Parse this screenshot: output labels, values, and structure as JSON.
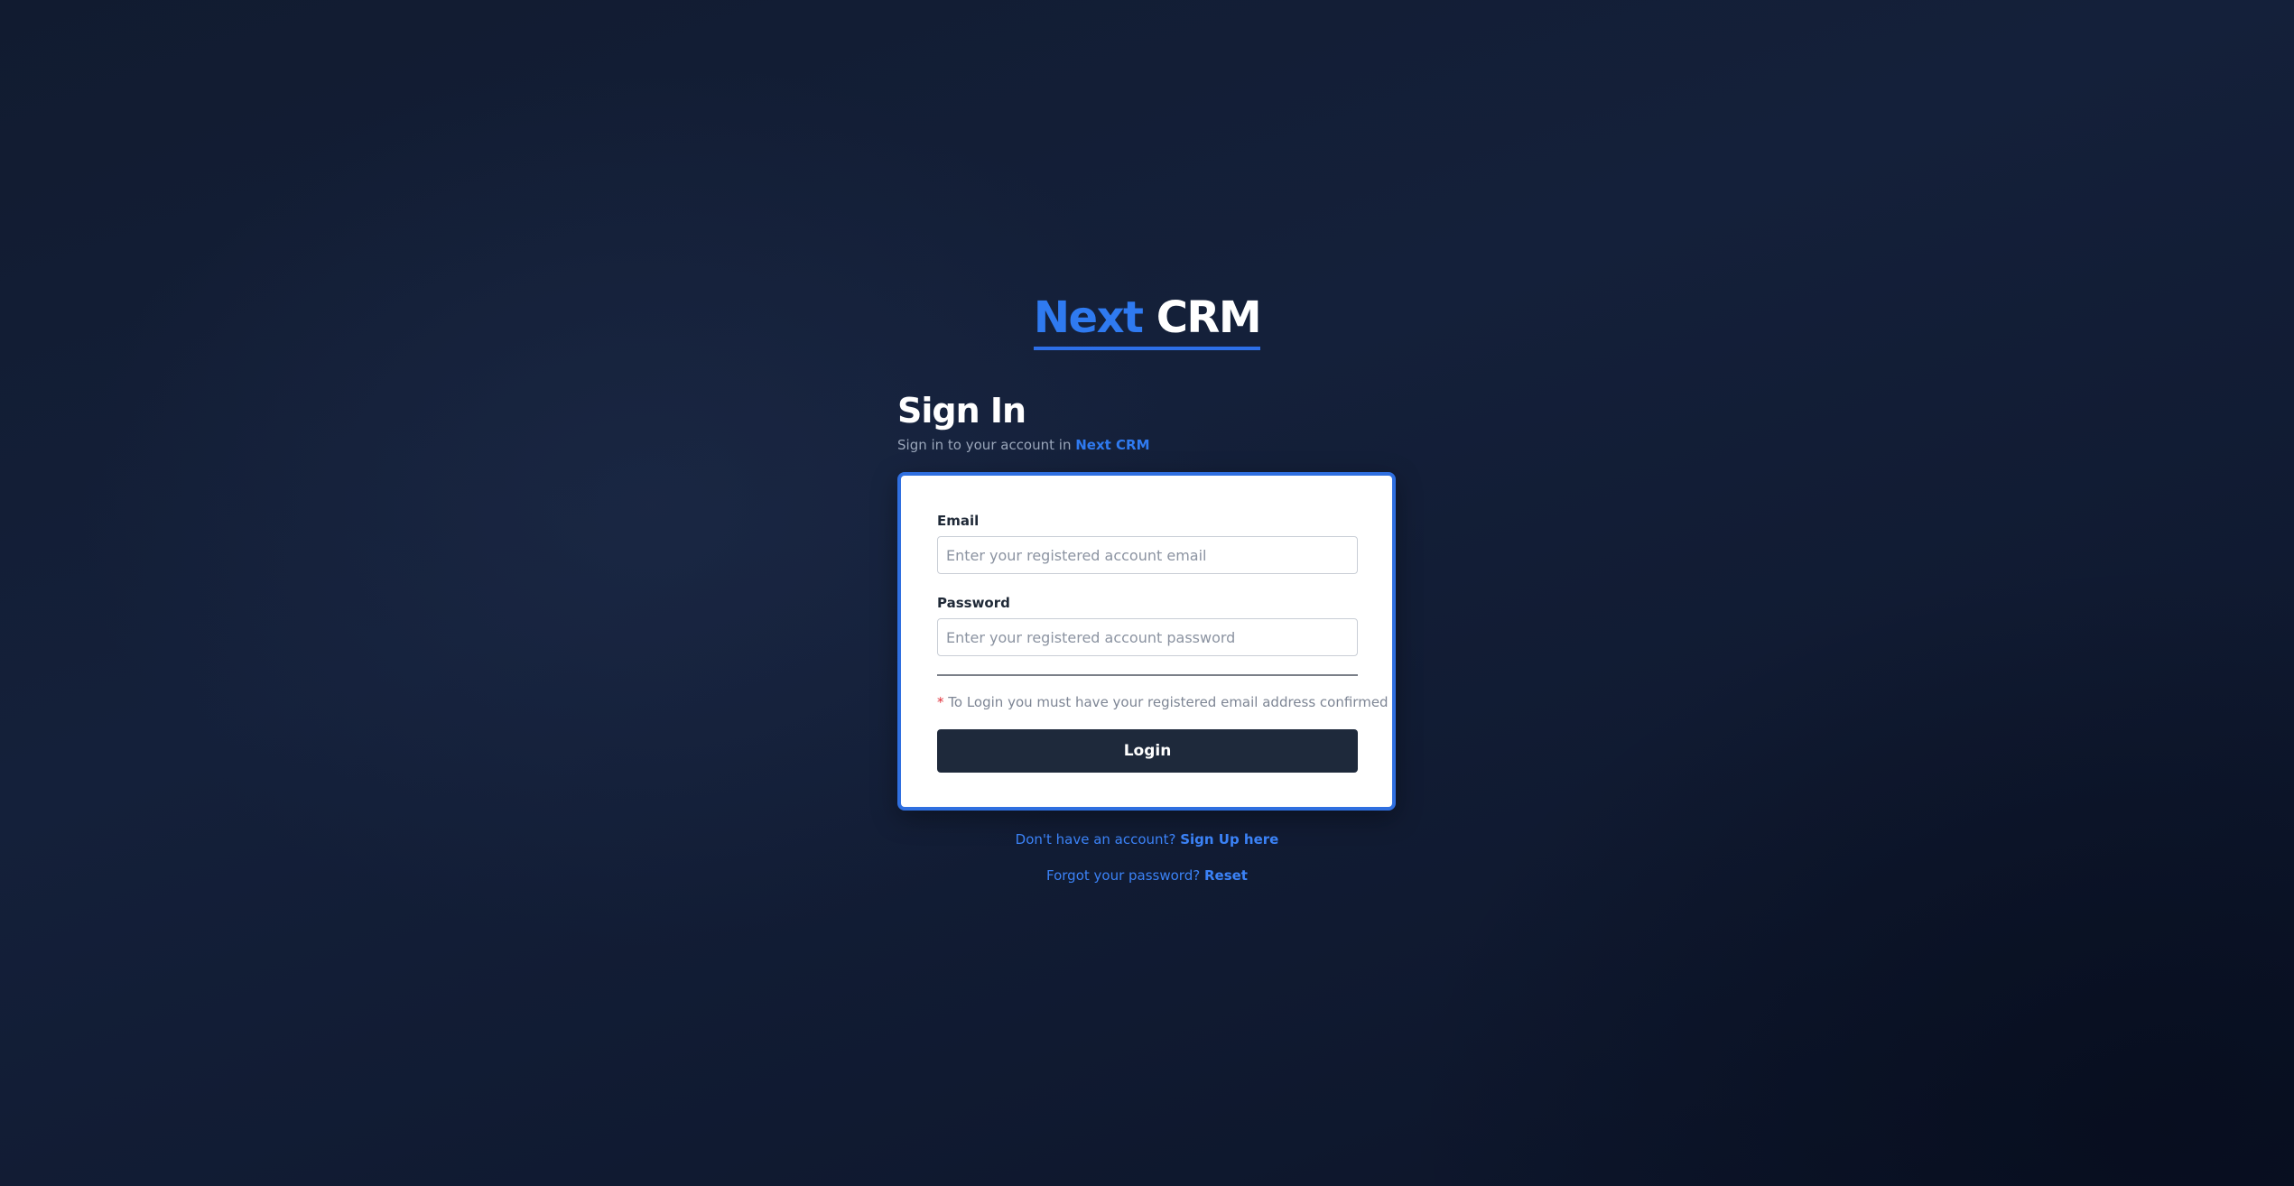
{
  "logo": {
    "part1": "Next",
    "part2": "CRM"
  },
  "heading": {
    "title": "Sign In",
    "subtitle_prefix": "Sign in to your account in",
    "brand": "Next CRM"
  },
  "form": {
    "email_label": "Email",
    "email_placeholder": "Enter your registered account email",
    "email_value": "",
    "password_label": "Password",
    "password_placeholder": "Enter your registered account password",
    "password_value": "",
    "notice_star": "*",
    "notice_text": "To Login you must have your registered email address confirmed",
    "login_label": "Login"
  },
  "footer": {
    "signup_prompt": "Don't have an account?",
    "signup_link": "Sign Up here",
    "forgot_prompt": "Forgot your password?",
    "forgot_link": "Reset"
  },
  "colors": {
    "accent": "#2f7af0",
    "card_border": "#2f6fe0",
    "button_bg": "#1e293b",
    "background": "#111b30",
    "required_star": "#e0303a"
  }
}
